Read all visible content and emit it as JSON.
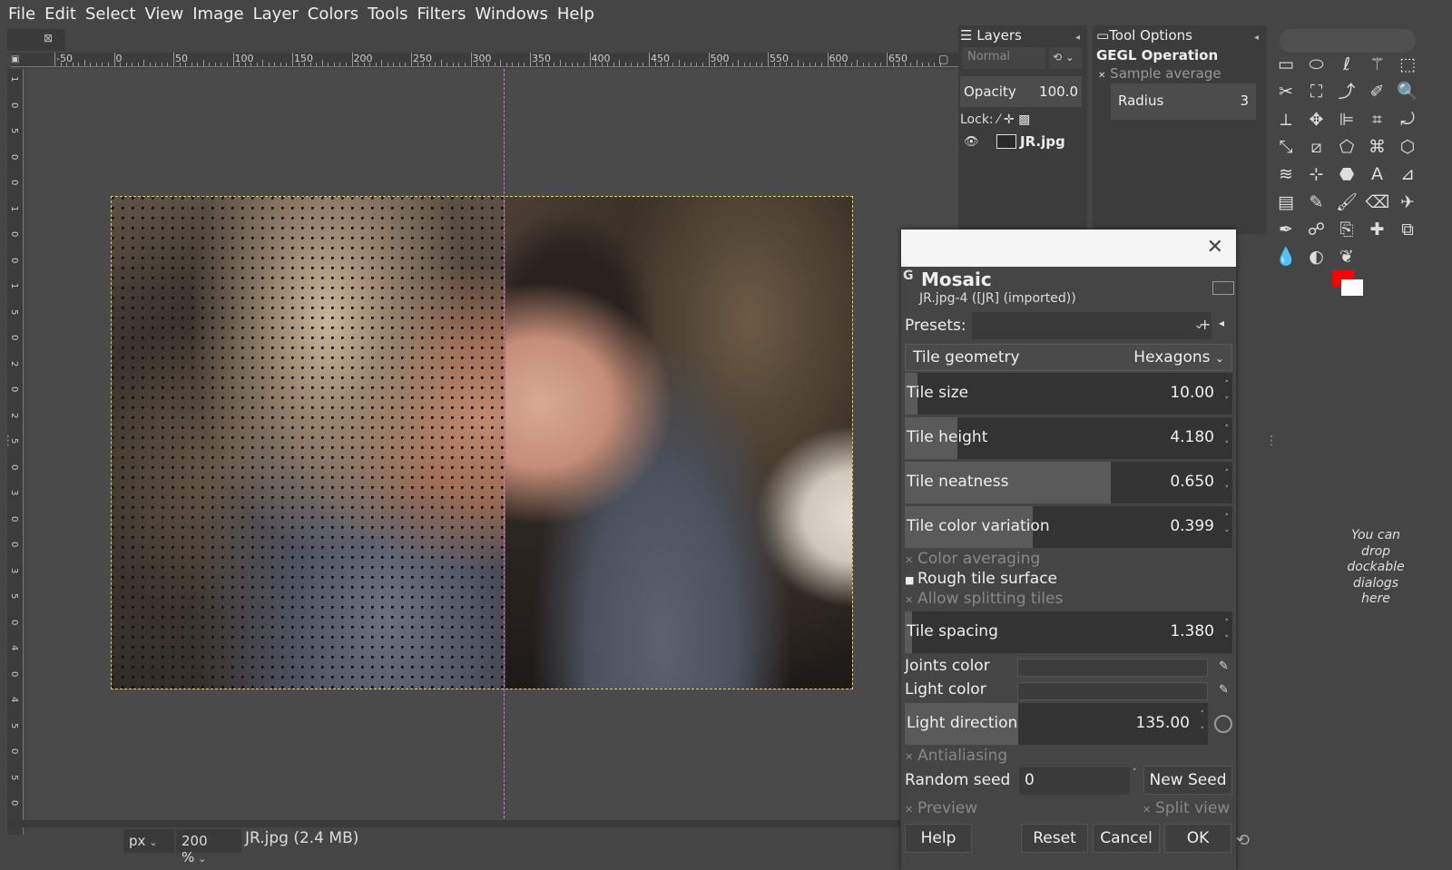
{
  "menu": [
    "File",
    "Edit",
    "Select",
    "View",
    "Image",
    "Layer",
    "Colors",
    "Tools",
    "Filters",
    "Windows",
    "Help"
  ],
  "ruler": {
    "top_labels": [
      "-50",
      "0",
      "50",
      "100",
      "150",
      "200",
      "250",
      "300",
      "350",
      "400",
      "450",
      "500",
      "550",
      "600",
      "650"
    ],
    "left_labels": [
      "1",
      "0",
      "5",
      "0",
      "0",
      "1",
      "0",
      "0",
      "1",
      "5",
      "0",
      "2",
      "0",
      "2",
      "5",
      "0",
      "3",
      "0",
      "0",
      "3",
      "5",
      "0",
      "4",
      "0",
      "4",
      "5",
      "0",
      "5",
      "0"
    ]
  },
  "status": {
    "unit": "px",
    "zoom": "200 %",
    "file": "JR.jpg (2.4 MB)"
  },
  "layers_panel": {
    "title": "Layers",
    "mode": "Normal",
    "opacity_label": "Opacity",
    "opacity_value": "100.0",
    "lock_label": "Lock:",
    "layer_name": "JR.jpg"
  },
  "tool_options": {
    "title": "Tool Options",
    "operation": "GEGL Operation",
    "sample_average": "Sample average",
    "radius_label": "Radius",
    "radius_value": "3"
  },
  "toolbox": {
    "icons": [
      "rect-select-icon",
      "ellipse-select-icon",
      "lasso-icon",
      "fuzzy-select-icon",
      "select-by-color-icon",
      "scissors-icon",
      "foreground-select-icon",
      "paths-icon",
      "color-picker-icon",
      "zoom-icon",
      "measure-icon",
      "move-icon",
      "align-icon",
      "crop-icon",
      "rotate-icon",
      "scale-icon",
      "shear-icon",
      "perspective-icon",
      "cage-icon",
      "unified-transform-icon",
      "warp-icon",
      "handle-transform-icon",
      "bucket-fill-icon",
      "text-icon",
      "blend-icon",
      "gradient-icon",
      "pencil-icon",
      "paintbrush-icon",
      "eraser-icon",
      "airbrush-icon",
      "ink-icon",
      "smudge-icon",
      "clone-icon",
      "heal-icon",
      "perspective-clone-icon",
      "blur-icon",
      "dodge-icon",
      "mypaint-icon"
    ],
    "fg_color": "#ff0000",
    "bg_color": "#ffffff",
    "drop_note": "You can drop dockable dialogs here"
  },
  "dialog": {
    "title": "Mosaic",
    "subtitle": "JR.jpg-4 ([JR] (imported))",
    "presets_label": "Presets:",
    "tile_geometry_label": "Tile geometry",
    "tile_geometry_value": "Hexagons",
    "spins": [
      {
        "label": "Tile size",
        "value": "10.00",
        "fraction": 0.04
      },
      {
        "label": "Tile height",
        "value": "4.180",
        "fraction": 0.16
      },
      {
        "label": "Tile neatness",
        "value": "0.650",
        "fraction": 0.63
      },
      {
        "label": "Tile color variation",
        "value": "0.399",
        "fraction": 0.39
      }
    ],
    "checks": [
      {
        "label": "Color averaging",
        "checked": true
      },
      {
        "label": "Rough tile surface",
        "checked": false
      },
      {
        "label": "Allow splitting tiles",
        "checked": true
      }
    ],
    "tile_spacing_label": "Tile spacing",
    "tile_spacing_value": "1.380",
    "joints_color_label": "Joints color",
    "light_color_label": "Light color",
    "light_direction_label": "Light direction",
    "light_direction_value": "135.00",
    "antialiasing_label": "Antialiasing",
    "random_seed_label": "Random seed",
    "random_seed_value": "0",
    "new_seed_label": "New Seed",
    "preview_label": "Preview",
    "split_view_label": "Split view",
    "buttons": {
      "help": "Help",
      "reset": "Reset",
      "cancel": "Cancel",
      "ok": "OK"
    }
  }
}
